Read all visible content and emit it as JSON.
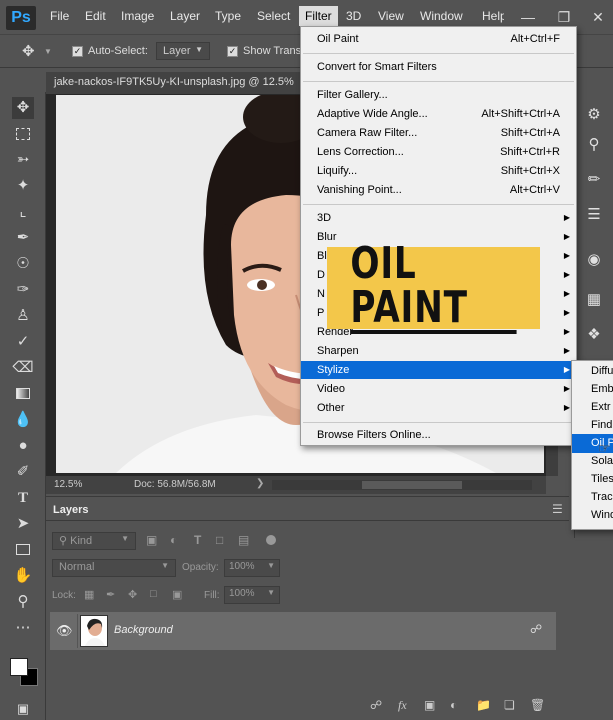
{
  "app": {
    "logo": "Ps"
  },
  "menubar": {
    "items": [
      "File",
      "Edit",
      "Image",
      "Layer",
      "Type",
      "Select",
      "Filter",
      "3D",
      "View",
      "Window",
      "Help"
    ],
    "active": "Filter"
  },
  "options": {
    "auto_select_label": "Auto-Select:",
    "auto_select_value": "Layer",
    "show_transform_label": "Show Transf"
  },
  "document": {
    "tab_title": "jake-nackos-IF9TK5Uy-KI-unsplash.jpg @ 12.5%",
    "zoom": "12.5%",
    "doc_size": "Doc: 56.8M/56.8M"
  },
  "filter_menu": {
    "top": [
      {
        "label": "Oil Paint",
        "shortcut": "Alt+Ctrl+F"
      }
    ],
    "convert": "Convert for Smart Filters",
    "filters": [
      {
        "label": "Filter Gallery...",
        "shortcut": ""
      },
      {
        "label": "Adaptive Wide Angle...",
        "shortcut": "Alt+Shift+Ctrl+A"
      },
      {
        "label": "Camera Raw Filter...",
        "shortcut": "Shift+Ctrl+A"
      },
      {
        "label": "Lens Correction...",
        "shortcut": "Shift+Ctrl+R"
      },
      {
        "label": "Liquify...",
        "shortcut": "Shift+Ctrl+X"
      },
      {
        "label": "Vanishing Point...",
        "shortcut": "Alt+Ctrl+V"
      }
    ],
    "groups": [
      "3D",
      "Blur",
      "Bl",
      "D",
      "N",
      "P",
      "Render",
      "Sharpen",
      "Stylize",
      "Video",
      "Other"
    ],
    "selected_group": "Stylize",
    "browse": "Browse Filters Online..."
  },
  "stylize_submenu": {
    "items": [
      "Diffu",
      "Emb",
      "Extr",
      "Find",
      "Oil P",
      "Solar",
      "Tiles",
      "Trac",
      "Wind"
    ],
    "selected": "Oil P"
  },
  "banner": {
    "text": "OIL PAINT",
    "color": "#f3c74a"
  },
  "layers_panel": {
    "tab": "Layers",
    "kind_placeholder": "Kind",
    "blend_mode": "Normal",
    "opacity_label": "Opacity:",
    "opacity_value": "100%",
    "lock_label": "Lock:",
    "fill_label": "Fill:",
    "fill_value": "100%",
    "layers": [
      {
        "name": "Background",
        "locked": true
      }
    ],
    "footer_icons": [
      "link-icon",
      "fx-icon",
      "mask-icon",
      "adjustment-icon",
      "group-icon",
      "new-layer-icon",
      "trash-icon"
    ]
  },
  "colors": {
    "accent": "#0a6ad6",
    "ui_bg": "#535353",
    "menu_bg": "#f0f0f0"
  }
}
